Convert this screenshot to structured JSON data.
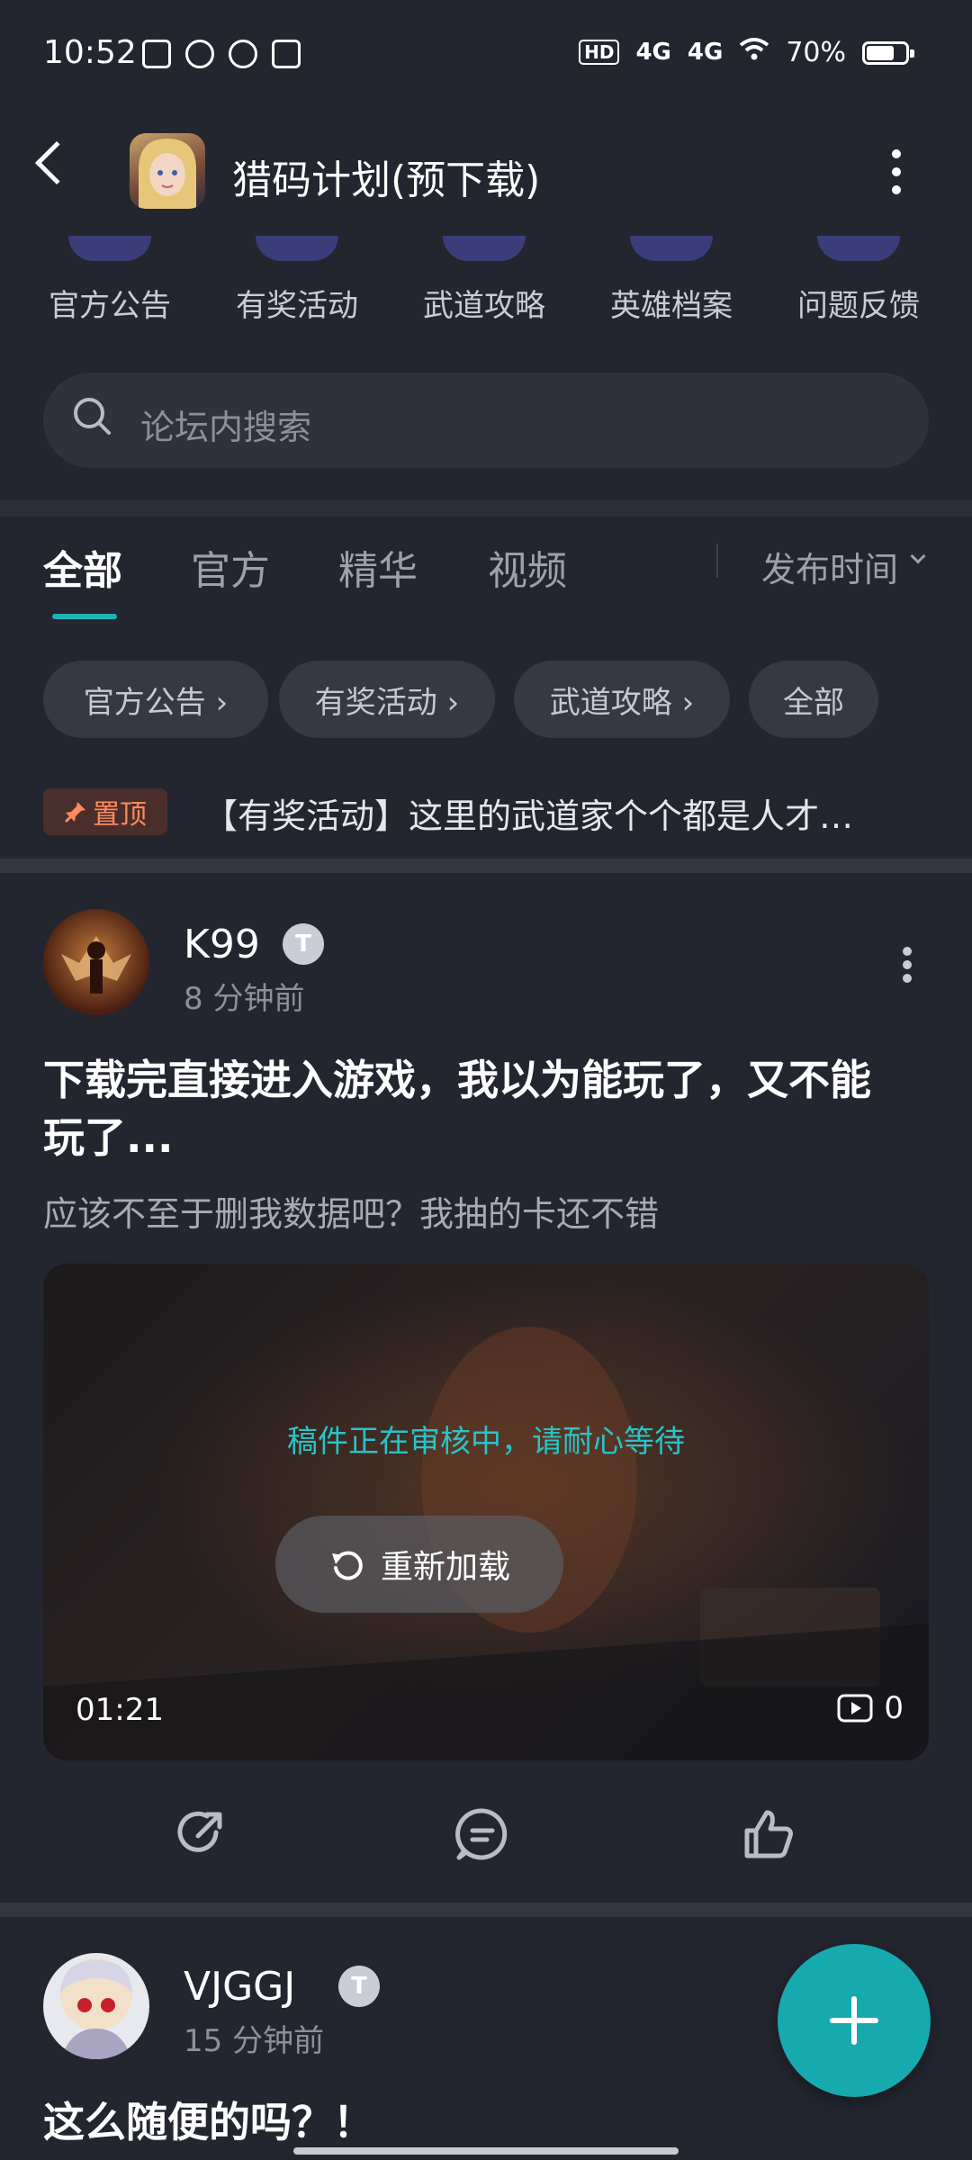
{
  "status_bar": {
    "time": "10:52",
    "hd_label": "HD",
    "net1": "4G",
    "net2": "4G",
    "battery": "70%"
  },
  "header": {
    "title": "猎码计划(预下载)"
  },
  "categories": [
    "官方公告",
    "有奖活动",
    "武道攻略",
    "英雄档案",
    "问题反馈"
  ],
  "search": {
    "placeholder": "论坛内搜索"
  },
  "tabs": [
    "全部",
    "官方",
    "精华",
    "视频"
  ],
  "active_tab": "全部",
  "sort_label": "发布时间",
  "chips": [
    "官方公告 ›",
    "有奖活动 ›",
    "武道攻略 ›",
    "全部"
  ],
  "pinned": {
    "badge": "置顶",
    "text": "【有奖活动】这里的武道家个个都是人才…"
  },
  "posts": [
    {
      "username": "K99",
      "badge": "T",
      "time": "8 分钟前",
      "title_line1": "下载完直接进入游戏，我以为能玩了，又不能",
      "title_line2": "玩了...",
      "subtitle": "应该不至于删我数据吧？我抽的卡还不错",
      "video": {
        "review_text": "稿件正在审核中，请耐心等待",
        "reload_label": "重新加载",
        "duration": "01:21",
        "views": "0"
      }
    },
    {
      "username": "VJGGJ",
      "badge": "T",
      "time": "15 分钟前",
      "title_line1": "这么随便的吗？！"
    }
  ],
  "colors": {
    "accent": "#1fb3b8",
    "fab": "#16a9ae",
    "background": "#23262f",
    "pinned_badge": "#ff8a5c"
  },
  "icons": [
    "back-arrow-icon",
    "more-vertical-icon",
    "search-icon",
    "pin-icon",
    "reload-icon",
    "play-icon",
    "share-icon",
    "comment-icon",
    "like-icon",
    "plus-icon"
  ]
}
